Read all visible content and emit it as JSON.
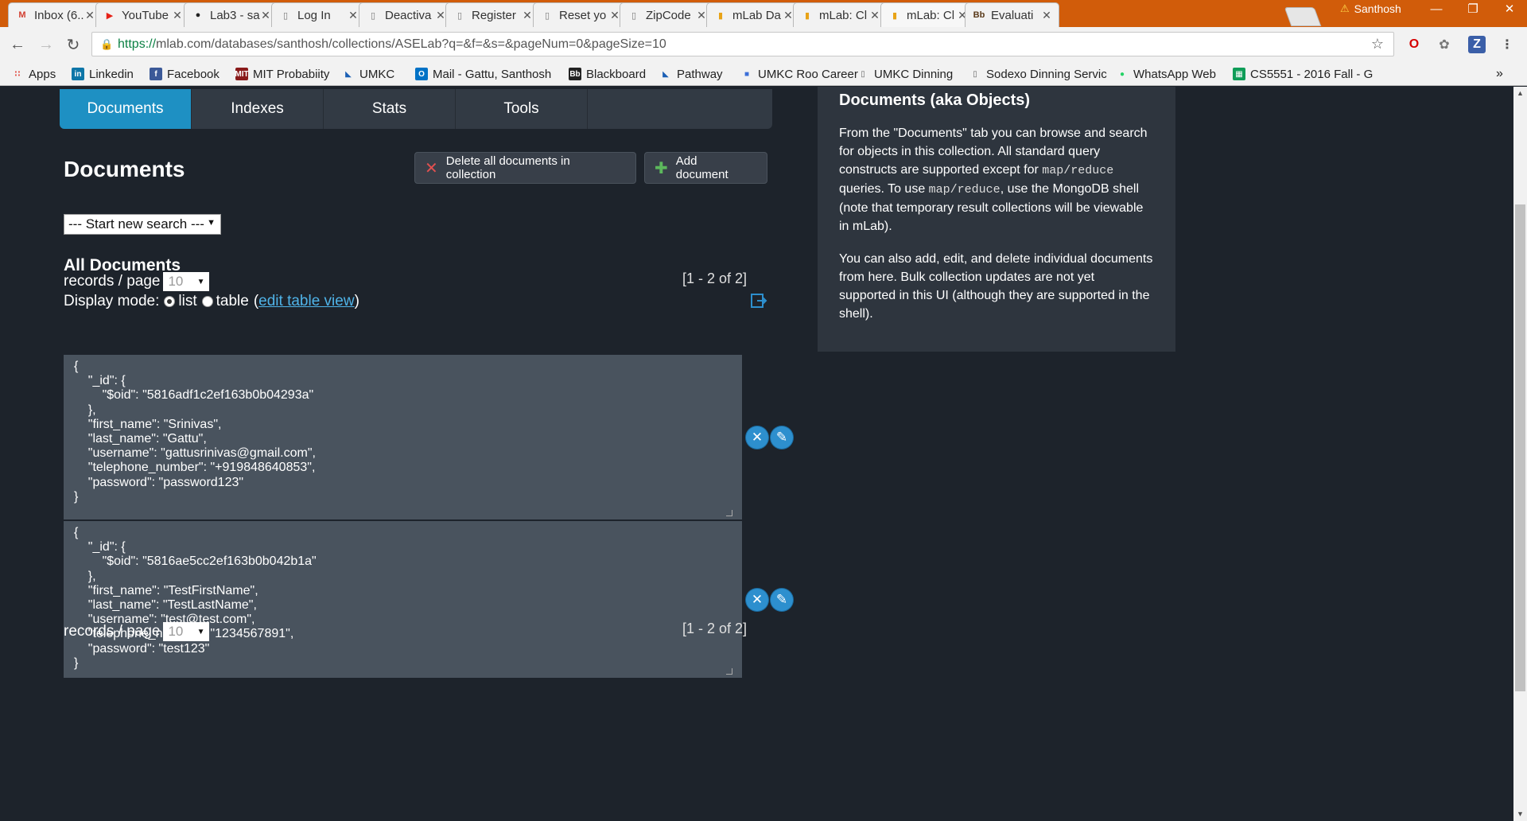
{
  "browser": {
    "tabs": [
      {
        "label": "Inbox (6...",
        "icon": "gmail-icon",
        "icon_color": "#d23f31"
      },
      {
        "label": "YouTube",
        "icon": "youtube-icon",
        "icon_color": "#e62117"
      },
      {
        "label": "Lab3 - sa",
        "icon": "github-icon",
        "icon_color": "#222222"
      },
      {
        "label": "Log In",
        "icon": "page-icon",
        "icon_color": "#777777"
      },
      {
        "label": "Deactiva",
        "icon": "page-icon",
        "icon_color": "#777777"
      },
      {
        "label": "Register",
        "icon": "page-icon",
        "icon_color": "#777777"
      },
      {
        "label": "Reset yo",
        "icon": "page-icon",
        "icon_color": "#777777"
      },
      {
        "label": "ZipCode",
        "icon": "page-icon",
        "icon_color": "#777777"
      },
      {
        "label": "mLab Da",
        "icon": "mlab-icon",
        "icon_color": "#e8a317"
      },
      {
        "label": "mLab: Cl",
        "icon": "mlab-icon",
        "icon_color": "#e8a317"
      },
      {
        "label": "mLab: Cl",
        "icon": "mlab-icon",
        "icon_color": "#e8a317"
      },
      {
        "label": "Evaluati",
        "icon": "blackboard-icon",
        "icon_color": "#5a3a1a"
      }
    ],
    "active_tab_index": 10,
    "profile_name": "Santhosh",
    "url_secure": "https://",
    "url_rest": "mlab.com/databases/santhosh/collections/ASELab?q=&f=&s=&pageNum=0&pageSize=10",
    "bookmarks": [
      {
        "label": "Apps",
        "icon": "apps-grid-icon"
      },
      {
        "label": "Linkedin",
        "icon": "linkedin-icon"
      },
      {
        "label": "Facebook",
        "icon": "facebook-icon"
      },
      {
        "label": "MIT Probabiity",
        "icon": "mit-icon"
      },
      {
        "label": "UMKC",
        "icon": "umkc-icon"
      },
      {
        "label": "Mail - Gattu, Santhosh",
        "icon": "outlook-icon"
      },
      {
        "label": "Blackboard",
        "icon": "blackboard-icon"
      },
      {
        "label": "Pathway",
        "icon": "umkc-icon"
      },
      {
        "label": "UMKC Roo Career",
        "icon": "roo-icon"
      },
      {
        "label": "UMKC Dinning",
        "icon": "page-icon"
      },
      {
        "label": "Sodexo Dinning Servic",
        "icon": "page-icon"
      },
      {
        "label": "WhatsApp Web",
        "icon": "whatsapp-icon"
      },
      {
        "label": "CS5551 - 2016 Fall - G",
        "icon": "sheets-icon"
      }
    ],
    "bookmarks_overflow": "»"
  },
  "colors": {
    "tabstrip": "#d15c0a",
    "page_bg": "#1d232b",
    "accent": "#1e90c3",
    "doc_bg": "#49535e",
    "help_bg": "#2e353e"
  },
  "collection": {
    "subtabs": [
      "Documents",
      "Indexes",
      "Stats",
      "Tools"
    ],
    "active_subtab": "Documents",
    "heading": "Documents",
    "delete_all_label": "Delete all documents in collection",
    "add_document_label": "Add document",
    "search_select_value": "--- Start new search ---",
    "all_documents_heading": "All Documents",
    "display_mode_label": "Display mode:",
    "mode_list_label": "list",
    "mode_table_label": "table",
    "edit_table_view_prefix": "(",
    "edit_table_view_label": "edit table view",
    "edit_table_view_suffix": ")",
    "selected_mode": "list",
    "records_per_page_label": "records / page",
    "records_per_page_value": "10",
    "range_text": "[1 - 2 of 2]",
    "documents": [
      {
        "_id_oid": "5816adf1c2ef163b0b04293a",
        "first_name": "Srinivas",
        "last_name": "Gattu",
        "username": "gattusrinivas@gmail.com",
        "telephone_number": "+919848640853",
        "password": "password123",
        "json_text": "{\n    \"_id\": {\n        \"$oid\": \"5816adf1c2ef163b0b04293a\"\n    },\n    \"first_name\": \"Srinivas\",\n    \"last_name\": \"Gattu\",\n    \"username\": \"gattusrinivas@gmail.com\",\n    \"telephone_number\": \"+919848640853\",\n    \"password\": \"password123\"\n}"
      },
      {
        "_id_oid": "5816ae5cc2ef163b0b042b1a",
        "first_name": "TestFirstName",
        "last_name": "TestLastName",
        "username": "test@test.com",
        "telephone_number": "1234567891",
        "password": "test123",
        "json_text": "{\n    \"_id\": {\n        \"$oid\": \"5816ae5cc2ef163b0b042b1a\"\n    },\n    \"first_name\": \"TestFirstName\",\n    \"last_name\": \"TestLastName\",\n    \"username\": \"test@test.com\",\n    \"telephone_number\": \"1234567891\",\n    \"password\": \"test123\"\n}"
      }
    ]
  },
  "help": {
    "title": "Documents (aka Objects)",
    "p1_a": "From the \"Documents\" tab you can browse and search for objects in this collection. All standard query constructs are supported except for ",
    "p1_code1": "map/reduce",
    "p1_b": " queries. To use ",
    "p1_code2": "map/reduce",
    "p1_c": ", use the MongoDB shell (note that temporary result collections will be viewable in mLab).",
    "p2": "You can also add, edit, and delete individual documents from here. Bulk collection updates are not yet supported in this UI (although they are supported in the shell)."
  }
}
